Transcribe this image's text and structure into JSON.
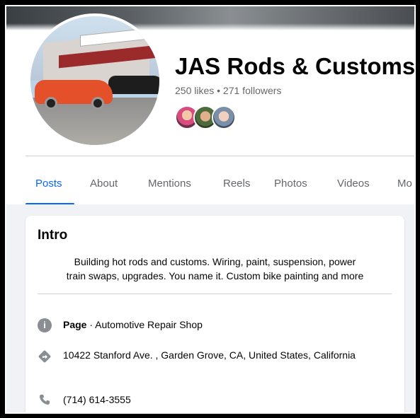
{
  "page": {
    "name": "JAS Rods & Customs",
    "stats": "250 likes • 271 followers"
  },
  "tabs": [
    {
      "label": "Posts",
      "active": true
    },
    {
      "label": "About",
      "active": false
    },
    {
      "label": "Mentions",
      "active": false
    },
    {
      "label": "Reels",
      "active": false
    },
    {
      "label": "Photos",
      "active": false
    },
    {
      "label": "Videos",
      "active": false
    },
    {
      "label": "Mo",
      "active": false
    }
  ],
  "intro": {
    "title": "Intro",
    "bio_line1": "Building hot rods and customs. Wiring, paint, suspension, power",
    "bio_line2": "train swaps, upgrades. You name it. Custom bike painting and more",
    "category_strong": "Page",
    "category_rest": " · Automotive Repair Shop",
    "address": "10422 Stanford Ave. , Garden Grove, CA, United States, California",
    "phone": "(714) 614-3555"
  },
  "icons": {
    "info": "info-icon",
    "address": "directions-icon",
    "phone": "phone-icon"
  },
  "colors": {
    "accent": "#0866ff",
    "secondary_text": "#65676b",
    "icon_gray": "#8a8d91"
  }
}
